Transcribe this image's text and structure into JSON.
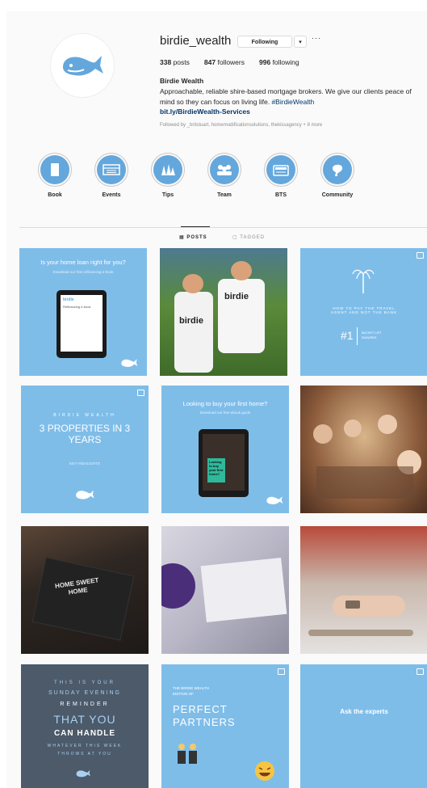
{
  "profile": {
    "username": "birdie_wealth",
    "following_label": "Following",
    "dropdown_glyph": "▾",
    "options_glyph": "···",
    "posts_count": "338",
    "posts_label": "posts",
    "followers_count": "847",
    "followers_label": "followers",
    "following_count": "996",
    "following_count_label": "following",
    "display_name": "Birdie Wealth",
    "bio": "Approachable, reliable shire-based mortgage brokers. We give our clients peace of mind so they can focus on living life.",
    "bio_hashtag": "#BirdieWealth",
    "link": "bit.ly/BirdieWealth-Services",
    "followed_by": "Followed by _britstuart, homemodificationsolutions, thekissagency + 8 more",
    "avatar_icon": "whale-logo-icon",
    "brand_color": "#64a7dc"
  },
  "highlights": [
    {
      "label": "Book",
      "icon": "book-icon"
    },
    {
      "label": "Events",
      "icon": "events-icon"
    },
    {
      "label": "Tips",
      "icon": "tips-icon"
    },
    {
      "label": "Team",
      "icon": "team-icon"
    },
    {
      "label": "BTS",
      "icon": "camera-icon"
    },
    {
      "label": "Community",
      "icon": "community-icon"
    }
  ],
  "tabs": {
    "posts": "POSTS",
    "tagged": "TAGGED"
  },
  "posts": {
    "p1_title": "Is your home loan right for you?",
    "p1_sub": "Download our free refinancing e-book",
    "p1_screen_brand": "birdie",
    "p1_screen_text": "Refinancing e-book",
    "p2_shirt": "birdie",
    "p3_title": "HOW TO PAY THE TRAVEL AGENT AND NOT THE BANK",
    "p3_big": "#1",
    "p3_side": "BUCKET LIST SUBURBS",
    "p5_brand": "BIRDIE WEALTH",
    "p5_title": "3 PROPERTIES IN 3 YEARS",
    "p5_sub": "KEY HIGHLIGHTS",
    "p6_title": "Looking to buy your first home?",
    "p6_sub": "Download our free ebook guide",
    "p6_screen": "Looking to buy your first home?",
    "p7_text": "HOME SWEET HOME",
    "p10_l1": "THIS IS YOUR",
    "p10_l2": "SUNDAY EVENING",
    "p10_l3": "REMINDER",
    "p10_l4": "THAT YOU",
    "p10_l5": "CAN HANDLE",
    "p10_l6": "WHATEVER THIS WEEK",
    "p10_l7": "THROWS AT YOU",
    "p11_sub": "THE BIRDIE WEALTH EDITION OF",
    "p11_title1": "PERFECT",
    "p11_title2": "PARTNERS",
    "p12_title": "Ask the experts"
  }
}
